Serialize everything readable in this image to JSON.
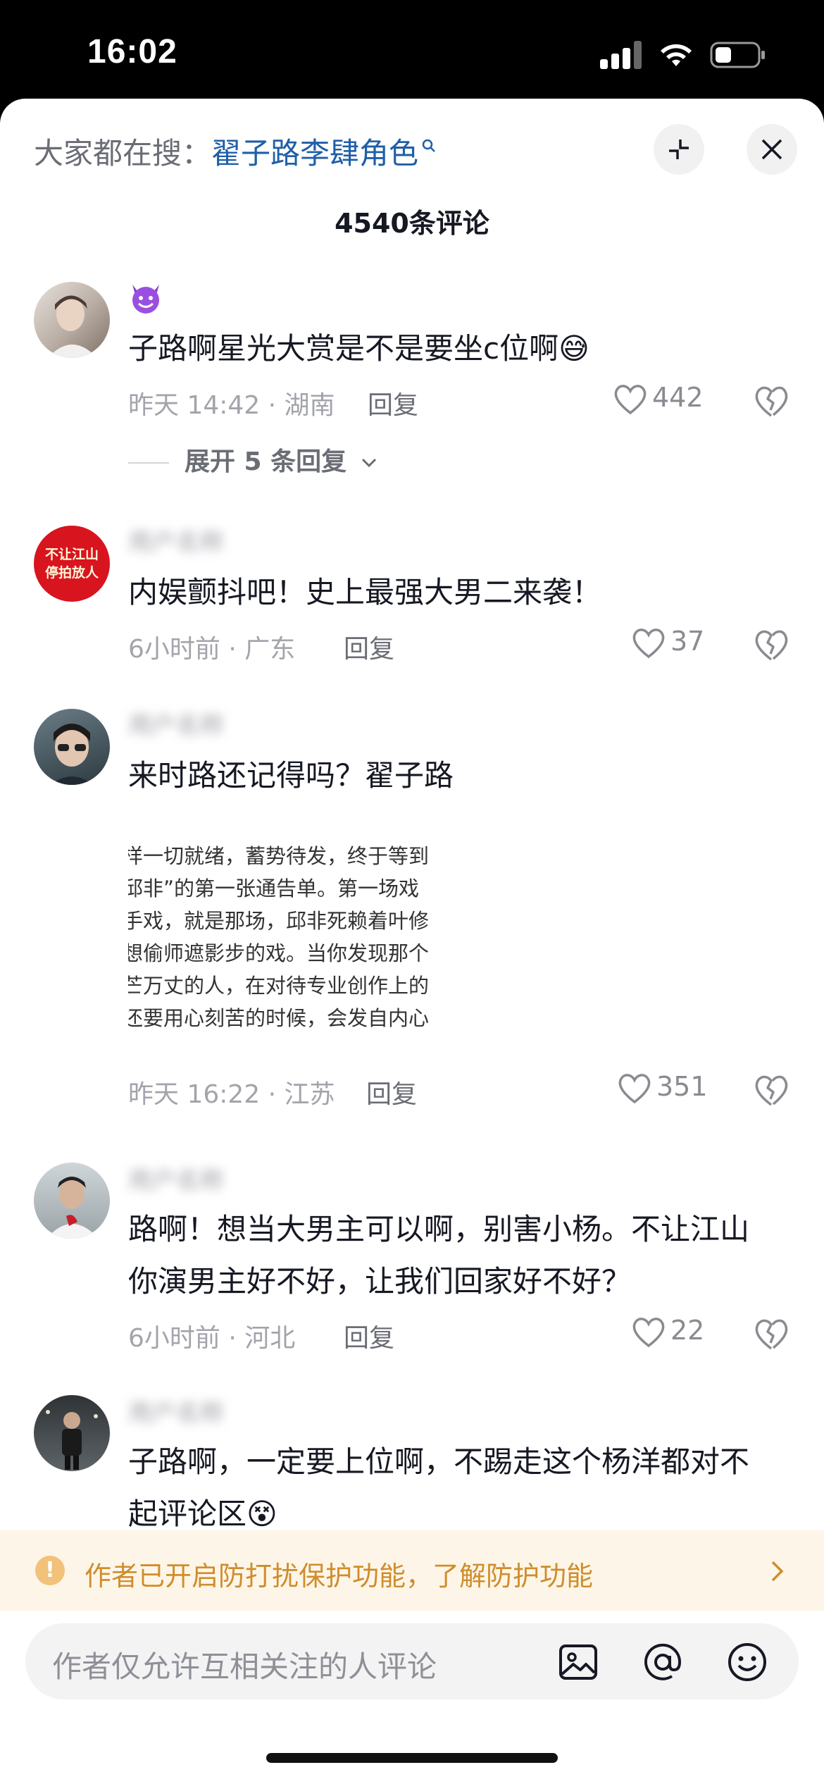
{
  "status_bar": {
    "time": "16:02"
  },
  "search_hint": {
    "prefix": "大家都在搜：",
    "keyword": "翟子路李肆角色"
  },
  "header": {
    "comment_count": "4540条评论"
  },
  "comments": [
    {
      "username": "",
      "text": "子路啊星光大赏是不是要坐c位啊😅",
      "time_location": "昨天 14:42 · 湖南",
      "reply_label": "回复",
      "likes": "442",
      "expand_label": "展开 5 条回复"
    },
    {
      "username": "",
      "avatar_text": "不让江山停拍放人",
      "text": "内娱颤抖吧！史上最强大男二来袭！",
      "time_location": "6小时前 · 广东",
      "reply_label": "回复",
      "likes": "37"
    },
    {
      "username": "",
      "text": "来时路还记得吗？翟子路",
      "image_lines": [
        "样一切就绪，蓄势待发，终于等到",
        "邱非”的第一张通告单。第一场戏",
        "手戏，就是那场，邱非死赖着叶修",
        "想偷师遮影步的戏。当你发现那个",
        "芒万丈的人，在对待专业创作上的",
        "还要用心刻苦的时候，会发自内心"
      ],
      "time_location": "昨天 16:22 · 江苏",
      "reply_label": "回复",
      "likes": "351"
    },
    {
      "username": "",
      "text": "路啊！想当大男主可以啊，别害小杨。不让江山你演男主好不好，让我们回家好不好？",
      "time_location": "6小时前 · 河北",
      "reply_label": "回复",
      "likes": "22"
    },
    {
      "username": "",
      "text": "子路啊，一定要上位啊，不踢走这个杨洋都对不起评论区😵"
    }
  ],
  "notice": {
    "text": "作者已开启防打扰保护功能，了解防护功能"
  },
  "input": {
    "placeholder": "作者仅允许互相关注的人评论"
  },
  "icons": {
    "search": "magnifier-icon",
    "collapse": "collapse-icon",
    "close": "close-icon",
    "like": "heart-icon",
    "dislike": "broken-heart-icon",
    "image": "image-icon",
    "mention": "at-icon",
    "emoji": "emoji-icon"
  },
  "colors": {
    "keyword": "#1f5fa8",
    "notice_bg": "#fdf6e8",
    "notice_text": "#d08d2c"
  }
}
